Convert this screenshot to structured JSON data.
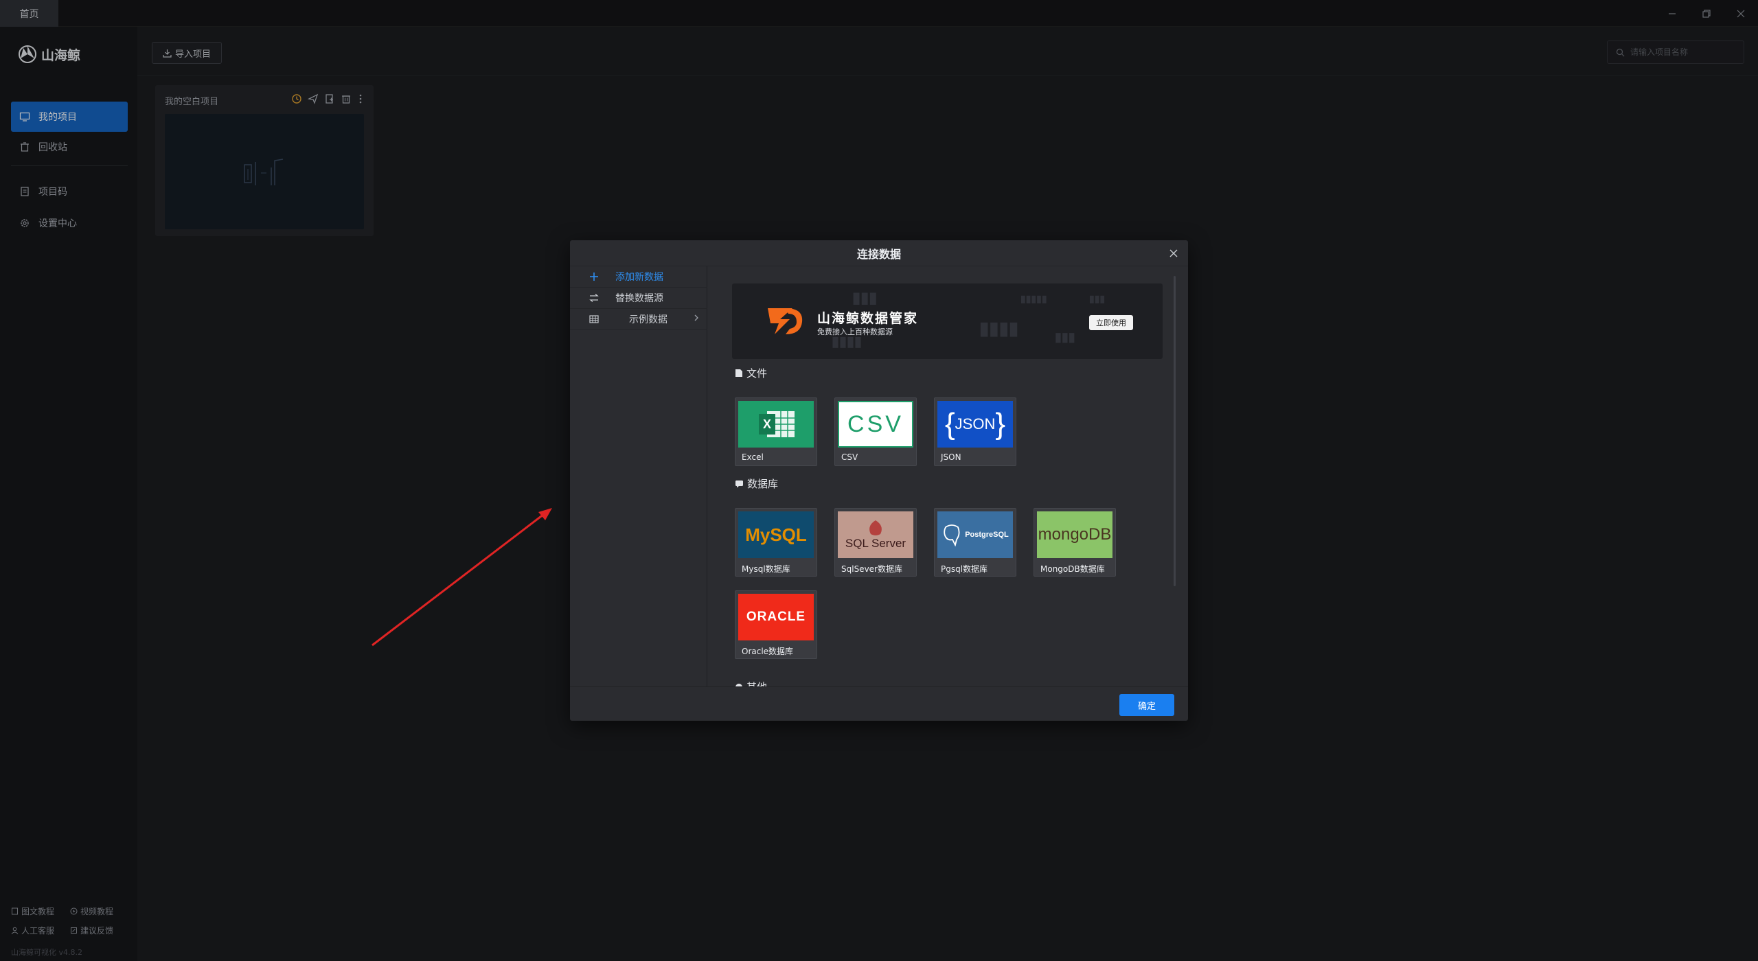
{
  "titlebar": {
    "tab_label": "首页"
  },
  "sidebar": {
    "app_name": "山海鲸",
    "items": [
      {
        "label": "我的项目"
      },
      {
        "label": "回收站"
      },
      {
        "label": "项目码"
      },
      {
        "label": "设置中心"
      }
    ],
    "footer": {
      "doc_tutorial": "图文教程",
      "video_tutorial": "视频教程",
      "support": "人工客服",
      "feedback": "建议反馈",
      "version": "山海鲸可视化 v4.8.2"
    }
  },
  "toolbar": {
    "import_label": "导入项目",
    "search_placeholder": "请输入项目名称"
  },
  "project": {
    "title": "我的空白项目"
  },
  "dialog": {
    "title": "连接数据",
    "menu": [
      {
        "label": "添加新数据"
      },
      {
        "label": "替换数据源"
      },
      {
        "label": "示例数据"
      }
    ],
    "banner": {
      "title": "山海鲸数据管家",
      "subtitle": "免费接入上百种数据源",
      "button": "立即使用"
    },
    "sections": {
      "files": "文件",
      "databases": "数据库",
      "other": "其他"
    },
    "file_tiles": [
      {
        "label": "Excel"
      },
      {
        "label": "CSV",
        "logo": "CSV"
      },
      {
        "label": "JSON",
        "logo": "JSON"
      }
    ],
    "db_tiles": [
      {
        "label": "Mysql数据库",
        "logo": "MySQL"
      },
      {
        "label": "SqlSever数据库",
        "logo": "SQL Server"
      },
      {
        "label": "Pgsql数据库",
        "logo": "PostgreSQL"
      },
      {
        "label": "MongoDB数据库",
        "logo": "mongoDB"
      },
      {
        "label": "Oracle数据库",
        "logo": "ORACLE"
      }
    ],
    "confirm": "确定"
  },
  "colors": {
    "accent": "#1a7ff0",
    "sidebar_active": "#1665c0",
    "excel_green": "#1e9e6a",
    "json_blue": "#1150c6",
    "mysql_navy": "#0f4b6e",
    "sqlserver_rose": "#c09a8e",
    "pg_blue": "#3a6fa1",
    "mongo_green": "#8bc468",
    "oracle_red": "#f02a1a",
    "annotation_red": "#e02424"
  }
}
